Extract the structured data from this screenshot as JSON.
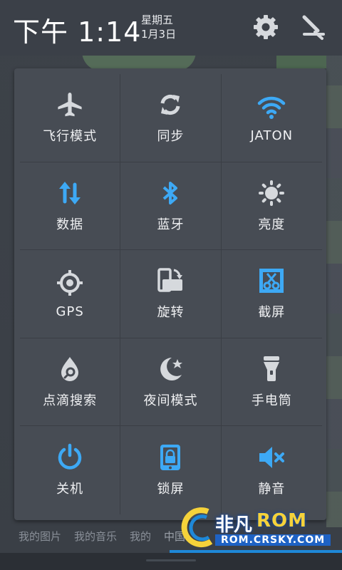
{
  "status": {
    "time": "下午 1:14",
    "weekday": "星期五",
    "date": "1月3日"
  },
  "header_icons": {
    "settings": "gear-icon",
    "edit": "edit-icon"
  },
  "colors": {
    "accent_blue": "#3da9f5",
    "icon_gray": "#d6d9dd",
    "panel_bg": "#474c54"
  },
  "toggles": [
    {
      "label": "飞行模式",
      "icon": "airplane-icon",
      "active": false
    },
    {
      "label": "同步",
      "icon": "sync-icon",
      "active": false
    },
    {
      "label": "JATON",
      "icon": "wifi-icon",
      "active": true
    },
    {
      "label": "数据",
      "icon": "data-icon",
      "active": true
    },
    {
      "label": "蓝牙",
      "icon": "bluetooth-icon",
      "active": true
    },
    {
      "label": "亮度",
      "icon": "brightness-icon",
      "active": false
    },
    {
      "label": "GPS",
      "icon": "gps-icon",
      "active": false
    },
    {
      "label": "旋转",
      "icon": "rotate-icon",
      "active": false
    },
    {
      "label": "截屏",
      "icon": "screenshot-icon",
      "active": true
    },
    {
      "label": "点滴搜索",
      "icon": "search-drop-icon",
      "active": false
    },
    {
      "label": "夜间模式",
      "icon": "night-mode-icon",
      "active": false
    },
    {
      "label": "手电筒",
      "icon": "flashlight-icon",
      "active": false
    },
    {
      "label": "关机",
      "icon": "power-icon",
      "active": true
    },
    {
      "label": "锁屏",
      "icon": "lock-screen-icon",
      "active": true
    },
    {
      "label": "静音",
      "icon": "mute-icon",
      "active": true
    }
  ],
  "background_tabs": [
    "我的图片",
    "我的音乐",
    "我的",
    "中国"
  ],
  "watermark": {
    "cn": "非凡",
    "en": "ROM",
    "url": "ROM.CRSKY.COM"
  }
}
